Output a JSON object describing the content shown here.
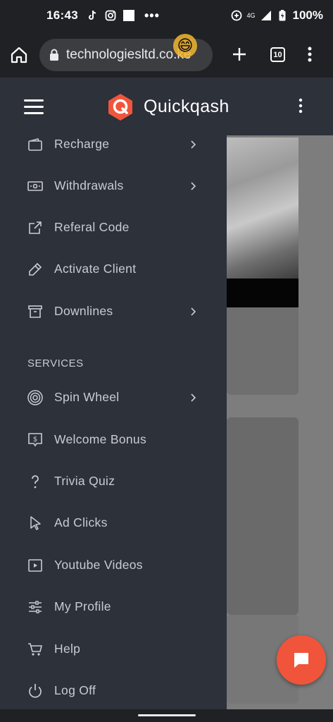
{
  "status_bar": {
    "time": "16:43",
    "network_label": "4G",
    "battery": "100%"
  },
  "browser": {
    "url": "technologiesltd.co.ke",
    "tab_count": "10"
  },
  "app": {
    "title": "Quickqash",
    "brand_color": "#f0553b"
  },
  "menu": {
    "items": [
      {
        "label": "Recharge",
        "icon": "wallet-icon",
        "has_chevron": true
      },
      {
        "label": "Withdrawals",
        "icon": "cash-icon",
        "has_chevron": true
      },
      {
        "label": "Referal Code",
        "icon": "external-link-icon",
        "has_chevron": false
      },
      {
        "label": "Activate Client",
        "icon": "pen-icon",
        "has_chevron": false
      },
      {
        "label": "Downlines",
        "icon": "archive-icon",
        "has_chevron": true
      }
    ],
    "section_title": "SERVICES",
    "services": [
      {
        "label": "Spin Wheel",
        "icon": "target-icon",
        "has_chevron": true
      },
      {
        "label": "Welcome Bonus",
        "icon": "dollar-message-icon",
        "has_chevron": false
      },
      {
        "label": "Trivia Quiz",
        "icon": "question-icon",
        "has_chevron": false
      },
      {
        "label": "Ad Clicks",
        "icon": "cursor-icon",
        "has_chevron": false
      },
      {
        "label": "Youtube Videos",
        "icon": "video-icon",
        "has_chevron": false
      },
      {
        "label": "My Profile",
        "icon": "sliders-icon",
        "has_chevron": false
      },
      {
        "label": "Help",
        "icon": "cart-icon",
        "has_chevron": false
      },
      {
        "label": "Log Off",
        "icon": "power-icon",
        "has_chevron": false
      }
    ]
  }
}
